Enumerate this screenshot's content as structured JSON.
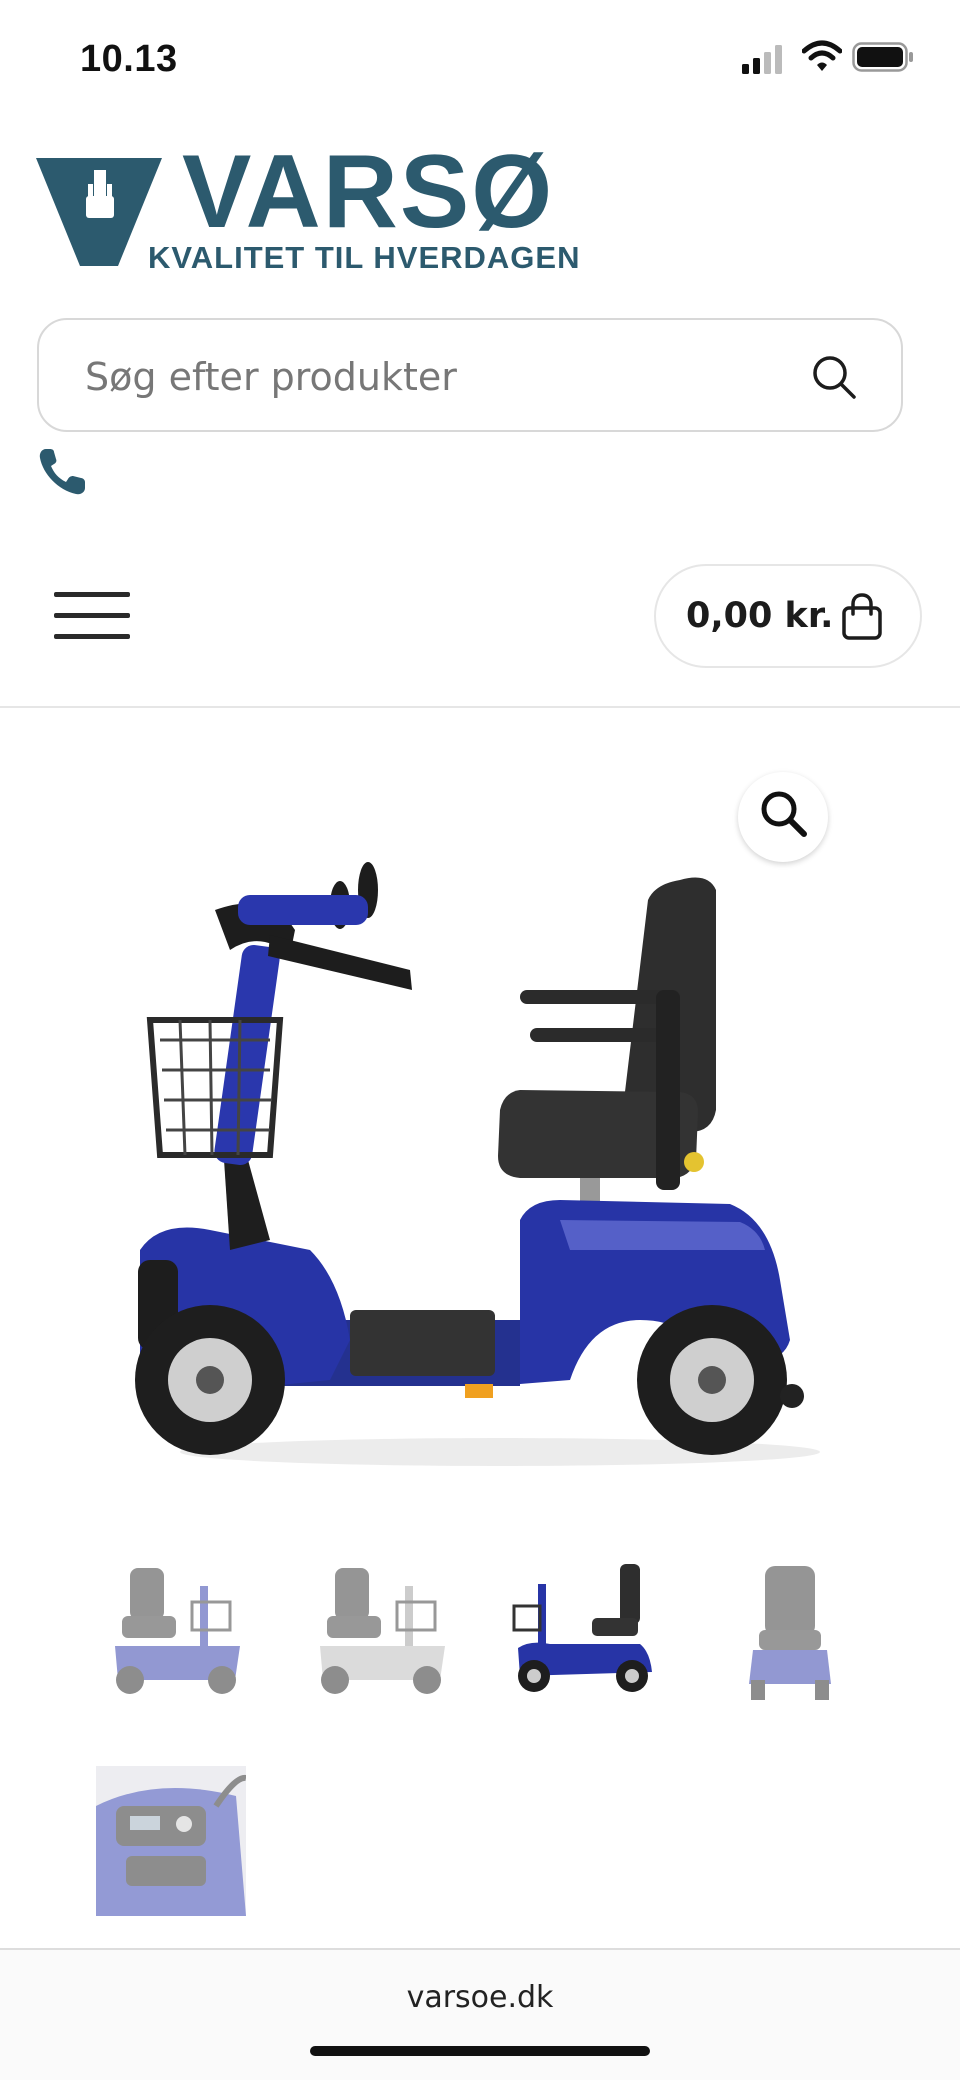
{
  "status_bar": {
    "time": "10.13",
    "icons": [
      "cellular-signal-icon",
      "wifi-icon",
      "battery-icon"
    ]
  },
  "header": {
    "logo": {
      "name": "VARSØ",
      "tagline": "KVALITET TIL HVERDAGEN",
      "brand_color": "#2c5a6e"
    },
    "search": {
      "placeholder": "Søg efter produkter",
      "value": "",
      "icon": "search-icon"
    },
    "phone_icon": "phone-icon"
  },
  "nav": {
    "menu_icon": "hamburger-menu-icon",
    "cart": {
      "total": "0,00 kr.",
      "icon": "shopping-bag-icon"
    }
  },
  "product_gallery": {
    "main_image": "blue-mobility-scooter-side-view",
    "zoom_icon": "magnifier-icon",
    "thumbnails": [
      {
        "name": "scooter-front-three-quarter-view",
        "active": false
      },
      {
        "name": "scooter-silver-variant-view",
        "active": false
      },
      {
        "name": "scooter-side-view",
        "active": true
      },
      {
        "name": "scooter-rear-view",
        "active": false
      },
      {
        "name": "scooter-control-panel-closeup",
        "active": false
      }
    ],
    "accent_color": "#2734a6"
  },
  "browser": {
    "url": "varsoe.dk"
  }
}
